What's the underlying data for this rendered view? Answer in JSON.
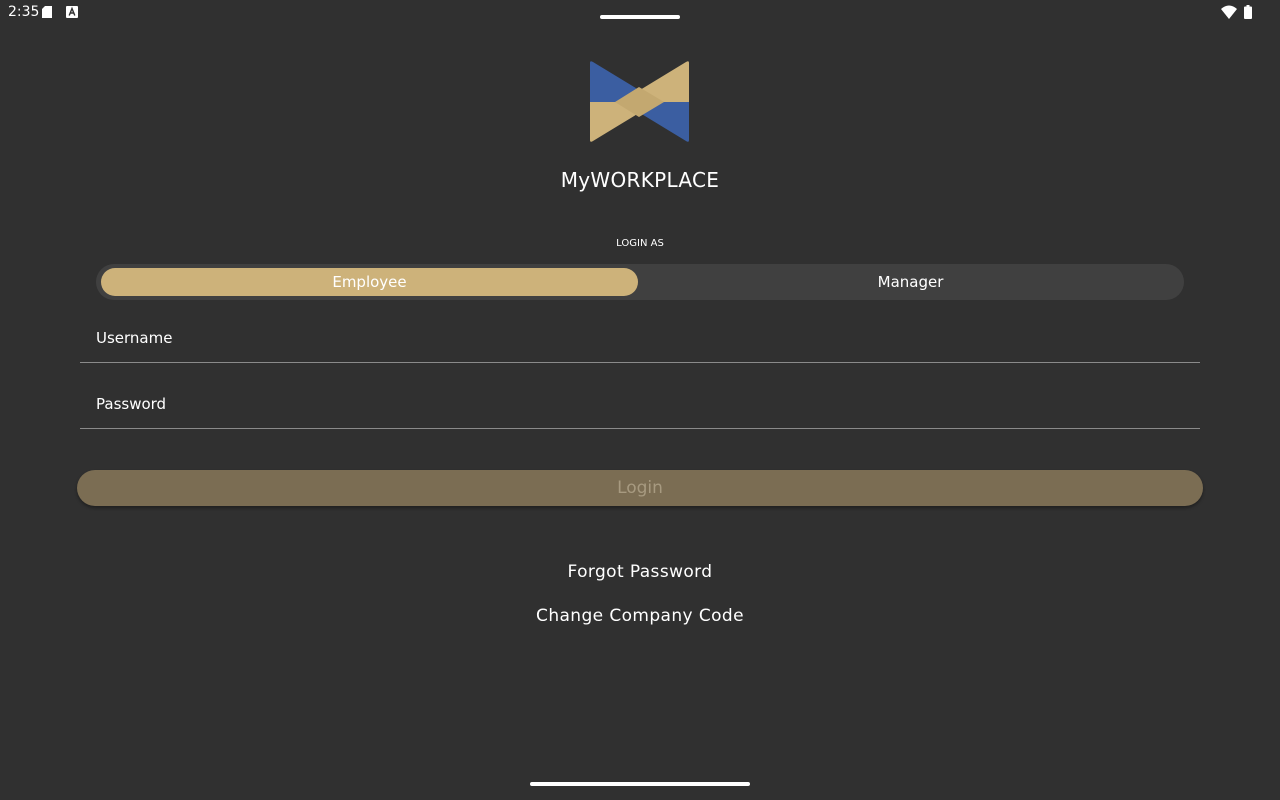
{
  "status_bar": {
    "time": "2:35",
    "icons": [
      "sd-card-icon",
      "a-notification-icon",
      "wifi-icon",
      "battery-icon"
    ]
  },
  "app": {
    "title": "MyWORKPLACE",
    "logo_icon": "myworkplace-logo-icon"
  },
  "login_as": {
    "label": "LOGIN AS",
    "options": [
      {
        "label": "Employee",
        "selected": true
      },
      {
        "label": "Manager",
        "selected": false
      }
    ]
  },
  "form": {
    "username": {
      "placeholder": "Username",
      "value": ""
    },
    "password": {
      "placeholder": "Password",
      "value": ""
    },
    "login_label": "Login"
  },
  "links": {
    "forgot_password": "Forgot Password",
    "change_company_code": "Change Company Code"
  },
  "colors": {
    "background": "#303030",
    "accent_gold": "#cdb27a",
    "accent_blue": "#3b5ea1",
    "login_button": "#7b6d53",
    "toggle_track": "#404040"
  }
}
